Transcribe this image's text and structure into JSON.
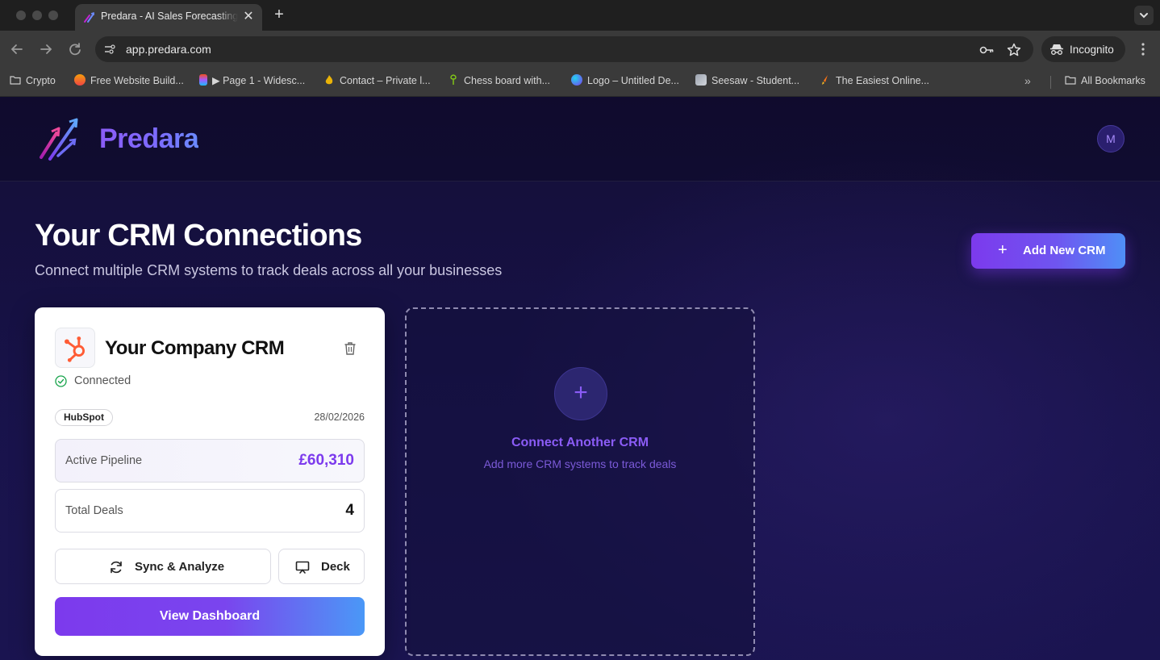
{
  "browser": {
    "tab_title": "Predara - AI Sales Forecasting",
    "tab_close": "✕",
    "new_tab": "+",
    "url": "app.predara.com",
    "profile_label": "Incognito"
  },
  "bookmarks": {
    "items": [
      {
        "label": "Crypto",
        "icon": "folder-icon"
      },
      {
        "label": "Free Website Build...",
        "icon": "site-favicon"
      },
      {
        "label": "▶ Page 1 - Widesc...",
        "icon": "figma-favicon"
      },
      {
        "label": "Contact – Private l...",
        "icon": "flame-favicon"
      },
      {
        "label": "Chess board with...",
        "icon": "leaf-favicon"
      },
      {
        "label": "Logo – Untitled De...",
        "icon": "canva-favicon"
      },
      {
        "label": "Seesaw - Student...",
        "icon": "seesaw-favicon"
      },
      {
        "label": "The Easiest Online...",
        "icon": "paint-favicon"
      }
    ],
    "more": "»",
    "all_bookmarks": "All Bookmarks"
  },
  "app": {
    "brand": "Predara",
    "avatar_initial": "M",
    "page_title": "Your CRM Connections",
    "page_subtitle": "Connect multiple CRM systems to track deals across all your businesses",
    "add_crm_plus": "+",
    "add_crm_label": "Add New CRM"
  },
  "crm_card": {
    "name": "Your Company CRM",
    "status": "Connected",
    "provider": "HubSpot",
    "date": "28/02/2026",
    "pipeline_label": "Active Pipeline",
    "pipeline_value": "£60,310",
    "deals_label": "Total Deals",
    "deals_value": "4",
    "sync_label": "Sync & Analyze",
    "deck_label": "Deck",
    "dashboard_label": "View Dashboard"
  },
  "connect_card": {
    "plus": "+",
    "title": "Connect Another CRM",
    "subtitle": "Add more CRM systems to track deals"
  },
  "colors": {
    "accent": "#7c3aed",
    "accent_blue": "#4a98f7",
    "hubspot": "#ff5c35",
    "connected_green": "#16a34a",
    "page_bg": "#140f37"
  }
}
